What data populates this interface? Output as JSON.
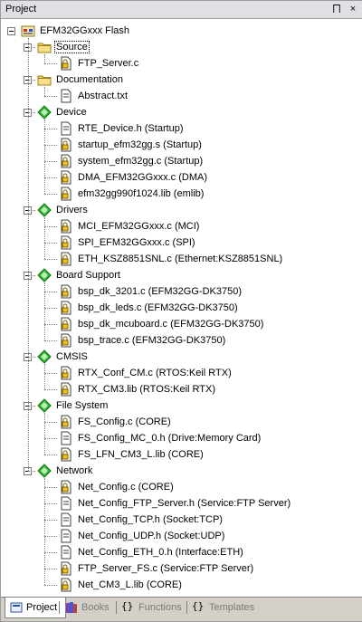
{
  "window": {
    "title": "Project",
    "pin_glyph": "⨅",
    "close_glyph": "×"
  },
  "tree": {
    "root": "EFM32GGxxx Flash",
    "groups": [
      {
        "label": "Source",
        "icon": "folder-icon",
        "files": [
          "FTP_Server.c"
        ]
      },
      {
        "label": "Documentation",
        "icon": "folder-icon",
        "files": [
          "Abstract.txt"
        ]
      },
      {
        "label": "Device",
        "icon": "component-icon",
        "files": [
          "RTE_Device.h (Startup)",
          "startup_efm32gg.s (Startup)",
          "system_efm32gg.c (Startup)",
          "DMA_EFM32GGxxx.c (DMA)",
          "efm32gg990f1024.lib (emlib)"
        ]
      },
      {
        "label": "Drivers",
        "icon": "component-icon",
        "files": [
          "MCI_EFM32GGxxx.c (MCI)",
          "SPI_EFM32GGxxx.c (SPI)",
          "ETH_KSZ8851SNL.c (Ethernet:KSZ8851SNL)"
        ]
      },
      {
        "label": "Board Support",
        "icon": "component-icon",
        "files": [
          "bsp_dk_3201.c (EFM32GG-DK3750)",
          "bsp_dk_leds.c (EFM32GG-DK3750)",
          "bsp_dk_mcuboard.c (EFM32GG-DK3750)",
          "bsp_trace.c (EFM32GG-DK3750)"
        ]
      },
      {
        "label": "CMSIS",
        "icon": "component-icon",
        "files": [
          "RTX_Conf_CM.c (RTOS:Keil RTX)",
          "RTX_CM3.lib (RTOS:Keil RTX)"
        ]
      },
      {
        "label": "File System",
        "icon": "component-icon",
        "files": [
          "FS_Config.c (CORE)",
          "FS_Config_MC_0.h (Drive:Memory Card)",
          "FS_LFN_CM3_L.lib (CORE)"
        ]
      },
      {
        "label": "Network",
        "icon": "component-icon",
        "files": [
          "Net_Config.c (CORE)",
          "Net_Config_FTP_Server.h (Service:FTP Server)",
          "Net_Config_TCP.h (Socket:TCP)",
          "Net_Config_UDP.h (Socket:UDP)",
          "Net_Config_ETH_0.h (Interface:ETH)",
          "FTP_Server_FS.c (Service:FTP Server)",
          "Net_CM3_L.lib (CORE)"
        ]
      }
    ]
  },
  "tabs": [
    {
      "label": "Project",
      "icon": "project-icon",
      "active": true
    },
    {
      "label": "Books",
      "icon": "books-icon",
      "active": false
    },
    {
      "label": "Functions",
      "icon": "functions-icon",
      "active": false
    },
    {
      "label": "Templates",
      "icon": "templates-icon",
      "active": false
    }
  ],
  "colors": {
    "component_green": "#2fb52f",
    "folder_yellow": "#f0d060"
  }
}
